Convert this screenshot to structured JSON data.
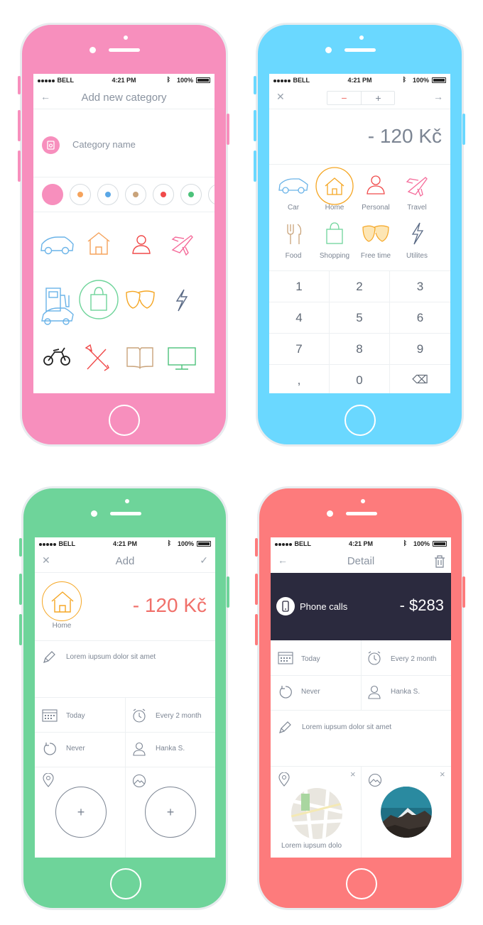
{
  "colors": {
    "pink": "#f78fbd",
    "blue": "#6ad8ff",
    "green": "#6ed49a",
    "red": "#fd7b7c",
    "dark_header": "#2b2a3e",
    "accent_orange": "#f5a623",
    "accent_red": "#f0706a"
  },
  "status_bar": {
    "carrier": "BELL",
    "time": "4:21 PM",
    "battery": "100%"
  },
  "screen1": {
    "title": "Add new category",
    "back_icon": "arrow-left-icon",
    "category_placeholder": "Category name",
    "color_swatches": [
      "#f78fbd",
      "#f5a35c",
      "#5aa7e6",
      "#c9a37a",
      "#f04a4a",
      "#4cc27a",
      "#f5a623"
    ],
    "icons": [
      "car-icon",
      "home-icon",
      "person-icon",
      "plane-icon",
      "gas-pump-icon",
      "shopping-bag-icon",
      "theater-masks-icon",
      "lightning-icon",
      "motorbike-icon",
      "tools-icon",
      "book-icon",
      "monitor-icon"
    ]
  },
  "screen2": {
    "close_icon": "close-icon",
    "minus_label": "−",
    "plus_label": "+",
    "next_icon": "arrow-right-icon",
    "amount": "- 120 Kč",
    "categories": [
      {
        "label": "Car",
        "icon": "car-icon"
      },
      {
        "label": "Home",
        "icon": "home-icon"
      },
      {
        "label": "Personal",
        "icon": "person-icon"
      },
      {
        "label": "Travel",
        "icon": "plane-icon"
      },
      {
        "label": "Food",
        "icon": "cutlery-icon"
      },
      {
        "label": "Shopping",
        "icon": "shopping-bag-icon"
      },
      {
        "label": "Free time",
        "icon": "theater-masks-icon"
      },
      {
        "label": "Utilites",
        "icon": "lightning-icon"
      }
    ],
    "keys": [
      "1",
      "2",
      "3",
      "4",
      "5",
      "6",
      "7",
      "8",
      "9",
      ",",
      "0",
      "⌫"
    ]
  },
  "screen3": {
    "title": "Add",
    "category": "Home",
    "amount": "- 120 Kč",
    "note": "Lorem iupsum dolor sit amet",
    "date": "Today",
    "repeat": "Every 2 month",
    "end": "Never",
    "person": "Hanka S.",
    "add_label": "+"
  },
  "screen4": {
    "title": "Detail",
    "category": "Phone calls",
    "amount": "- $283",
    "date": "Today",
    "repeat": "Every 2 month",
    "end": "Never",
    "person": "Hanka S.",
    "note": "Lorem iupsum dolor sit amet",
    "location_caption": "Lorem iupsum dolo",
    "remove_label": "×"
  }
}
